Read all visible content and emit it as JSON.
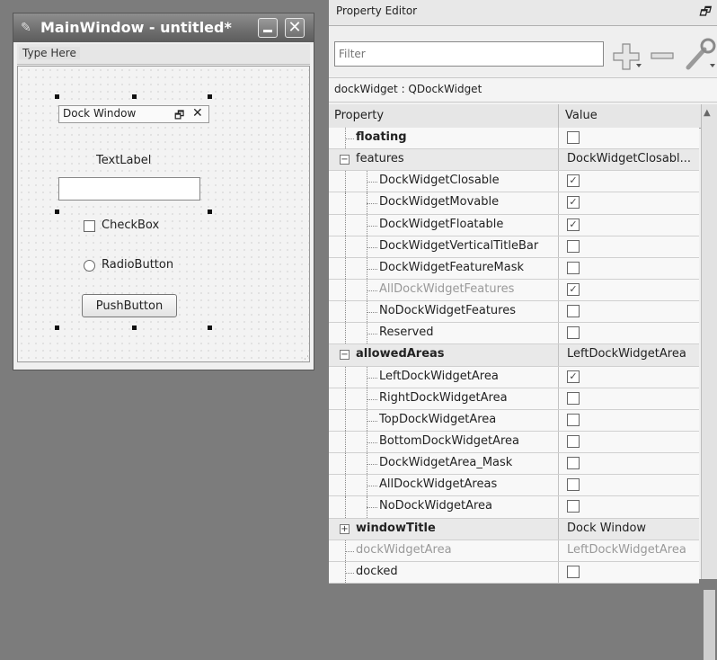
{
  "main_window": {
    "title": "MainWindow - untitled*",
    "menu_placeholder": "Type Here",
    "dock_title": "Dock Window",
    "text_label": "TextLabel",
    "checkbox_label": "CheckBox",
    "radio_label": "RadioButton",
    "push_button_label": "PushButton"
  },
  "property_editor": {
    "title": "Property Editor",
    "filter_placeholder": "Filter",
    "object_line": "dockWidget : QDockWidget",
    "col_property": "Property",
    "col_value": "Value",
    "rows": [
      {
        "name": "floating",
        "depth": 1,
        "bold": true,
        "value_type": "check",
        "checked": false
      },
      {
        "name": "features",
        "depth": 0,
        "expander": "−",
        "value_type": "text",
        "value": "DockWidgetClosabl..."
      },
      {
        "name": "DockWidgetClosable",
        "depth": 2,
        "value_type": "check",
        "checked": true
      },
      {
        "name": "DockWidgetMovable",
        "depth": 2,
        "value_type": "check",
        "checked": true
      },
      {
        "name": "DockWidgetFloatable",
        "depth": 2,
        "value_type": "check",
        "checked": true
      },
      {
        "name": "DockWidgetVerticalTitleBar",
        "depth": 2,
        "value_type": "check",
        "checked": false
      },
      {
        "name": "DockWidgetFeatureMask",
        "depth": 2,
        "value_type": "check",
        "checked": false
      },
      {
        "name": "AllDockWidgetFeatures",
        "depth": 2,
        "disabled": true,
        "value_type": "check",
        "checked": true
      },
      {
        "name": "NoDockWidgetFeatures",
        "depth": 2,
        "value_type": "check",
        "checked": false
      },
      {
        "name": "Reserved",
        "depth": 2,
        "value_type": "check",
        "checked": false
      },
      {
        "name": "allowedAreas",
        "depth": 0,
        "bold": true,
        "expander": "−",
        "value_type": "text",
        "value": "LeftDockWidgetArea"
      },
      {
        "name": "LeftDockWidgetArea",
        "depth": 2,
        "value_type": "check",
        "checked": true
      },
      {
        "name": "RightDockWidgetArea",
        "depth": 2,
        "value_type": "check",
        "checked": false
      },
      {
        "name": "TopDockWidgetArea",
        "depth": 2,
        "value_type": "check",
        "checked": false
      },
      {
        "name": "BottomDockWidgetArea",
        "depth": 2,
        "value_type": "check",
        "checked": false
      },
      {
        "name": "DockWidgetArea_Mask",
        "depth": 2,
        "value_type": "check",
        "checked": false
      },
      {
        "name": "AllDockWidgetAreas",
        "depth": 2,
        "value_type": "check",
        "checked": false
      },
      {
        "name": "NoDockWidgetArea",
        "depth": 2,
        "value_type": "check",
        "checked": false
      },
      {
        "name": "windowTitle",
        "depth": 0,
        "bold": true,
        "expander": "+",
        "value_type": "text",
        "value": "Dock Window"
      },
      {
        "name": "dockWidgetArea",
        "depth": 1,
        "disabled": true,
        "value_type": "text",
        "value": "LeftDockWidgetArea"
      },
      {
        "name": "docked",
        "depth": 1,
        "value_type": "check",
        "checked": false
      }
    ]
  },
  "icons": {
    "app": "qt-designer-icon",
    "float": "float-window-icon",
    "close": "close-icon",
    "add": "plus-icon",
    "remove": "minus-icon",
    "configure": "wrench-icon",
    "check_mark": "✓"
  }
}
